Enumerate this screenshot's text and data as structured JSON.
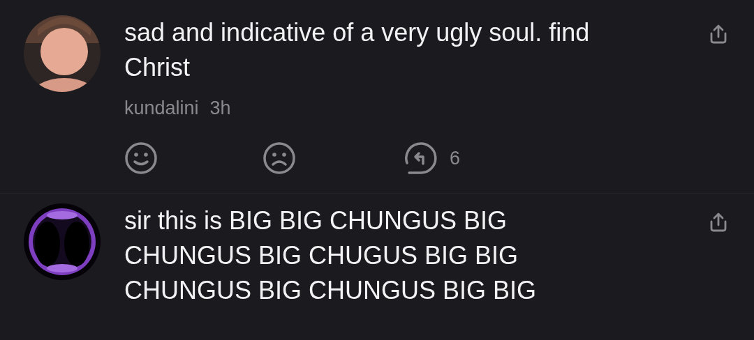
{
  "comments": [
    {
      "text": "sad and indicative of a very ugly soul. find Christ",
      "username": "kundalini",
      "time": "3h",
      "reply_count": "6"
    },
    {
      "text": "sir this is BIG BIG CHUNGUS BIG CHUNGUS BIG CHUGUS BIG BIG CHUNGUS BIG CHUNGUS BIG BIG"
    }
  ]
}
